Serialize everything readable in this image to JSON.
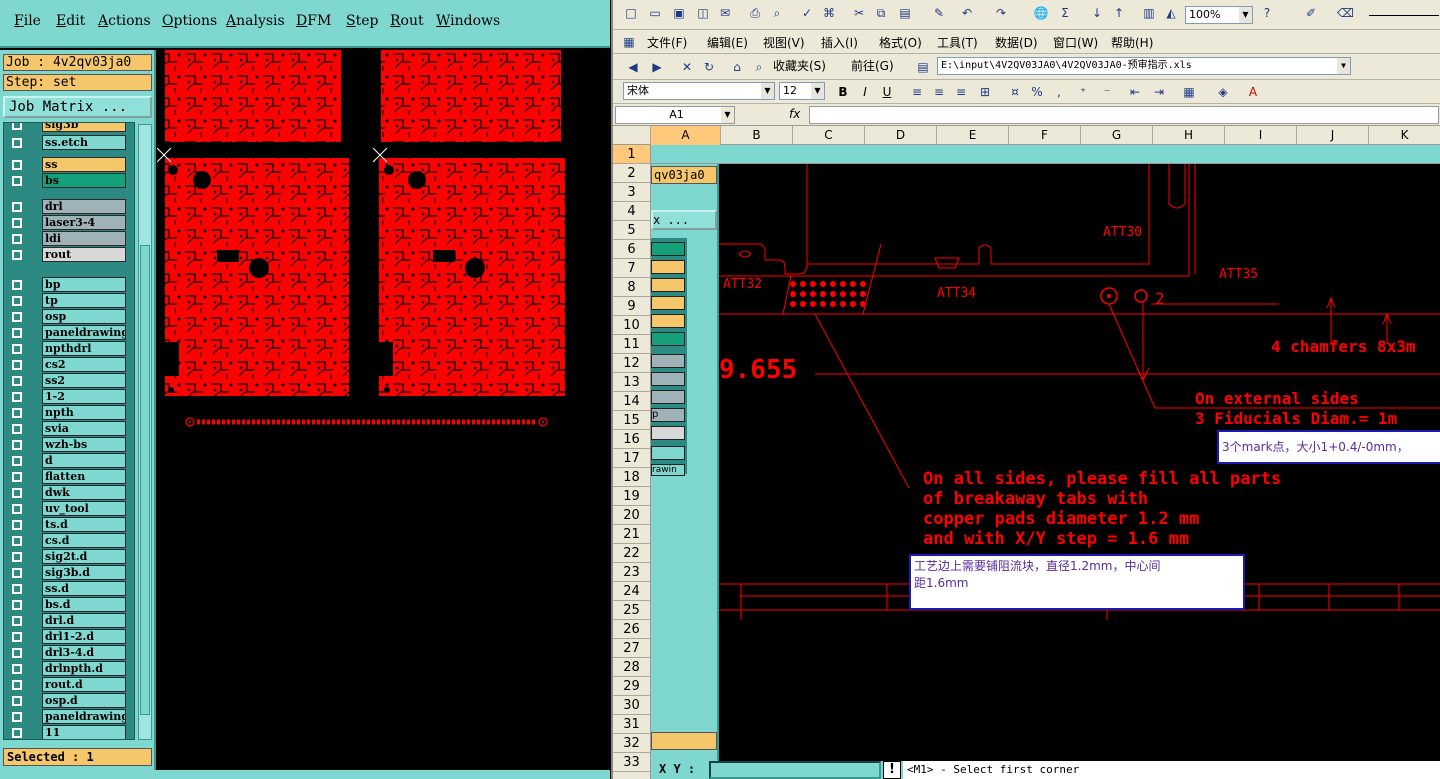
{
  "genesis": {
    "menu": [
      "File",
      "Edit",
      "Actions",
      "Options",
      "Analysis",
      "DFM",
      "Step",
      "Rout",
      "Windows"
    ],
    "job_label": "Job : 4v2qv03ja0",
    "step_label": "Step: set",
    "job_matrix_button": "Job Matrix ...",
    "layers": [
      {
        "name": "sig3b",
        "color": "yellow"
      },
      {
        "name": "ss.etch",
        "color": "plain"
      },
      {
        "name": "ss",
        "color": "yellow"
      },
      {
        "name": "bs",
        "color": "green"
      },
      {
        "name": "drl",
        "color": "gray"
      },
      {
        "name": "laser3-4",
        "color": "gray"
      },
      {
        "name": "ldi",
        "color": "gray"
      },
      {
        "name": "rout",
        "color": "lgray"
      },
      {
        "name": "bp",
        "color": "plain"
      },
      {
        "name": "tp",
        "color": "plain"
      },
      {
        "name": "osp",
        "color": "plain"
      },
      {
        "name": "paneldrawing",
        "color": "plain"
      },
      {
        "name": "npthdrl",
        "color": "plain"
      },
      {
        "name": "cs2",
        "color": "plain"
      },
      {
        "name": "ss2",
        "color": "plain"
      },
      {
        "name": "1-2",
        "color": "plain"
      },
      {
        "name": "npth",
        "color": "plain"
      },
      {
        "name": "svia",
        "color": "plain"
      },
      {
        "name": "wzh-bs",
        "color": "plain"
      },
      {
        "name": "d",
        "color": "plain"
      },
      {
        "name": "flatten",
        "color": "plain"
      },
      {
        "name": "dwk",
        "color": "plain"
      },
      {
        "name": "uv_tool",
        "color": "plain"
      },
      {
        "name": "ts.d",
        "color": "plain"
      },
      {
        "name": "cs.d",
        "color": "plain"
      },
      {
        "name": "sig2t.d",
        "color": "plain"
      },
      {
        "name": "sig3b.d",
        "color": "plain"
      },
      {
        "name": "ss.d",
        "color": "plain"
      },
      {
        "name": "bs.d",
        "color": "plain"
      },
      {
        "name": "drl.d",
        "color": "plain"
      },
      {
        "name": "drl1-2.d",
        "color": "plain"
      },
      {
        "name": "drl3-4.d",
        "color": "plain"
      },
      {
        "name": "drlnpth.d",
        "color": "plain"
      },
      {
        "name": "rout.d",
        "color": "plain"
      },
      {
        "name": "osp.d",
        "color": "plain"
      },
      {
        "name": "paneldrawing",
        "color": "plain"
      },
      {
        "name": "11",
        "color": "plain"
      }
    ],
    "selected_label": "Selected : 1"
  },
  "excel": {
    "menu": [
      "文件(F)",
      "编辑(E)",
      "视图(V)",
      "插入(I)",
      "格式(O)",
      "工具(T)",
      "数据(D)",
      "窗口(W)",
      "帮助(H)"
    ],
    "zoom": "100%",
    "favorites": "收藏夹(S)",
    "goto": "前往(G)",
    "address": "E:\\input\\4V2QV03JA0\\4V2QV03JA0-预审指示.xls",
    "font_name": "宋体",
    "font_size": "12",
    "name_box": "A1",
    "fx": "fx",
    "columns": [
      "A",
      "B",
      "C",
      "D",
      "E",
      "F",
      "G",
      "H",
      "I",
      "J",
      "K"
    ],
    "rows": [
      "1",
      "2",
      "3",
      "4",
      "5",
      "6",
      "7",
      "8",
      "9",
      "10",
      "11",
      "12",
      "13",
      "14",
      "15",
      "16",
      "17",
      "18",
      "19",
      "20",
      "21",
      "22",
      "23",
      "24",
      "25",
      "26",
      "27",
      "28",
      "29",
      "30",
      "31",
      "32",
      "33"
    ],
    "embedded": {
      "job_fragment": "qv03ja0",
      "matrix_fragment": "x ...",
      "layer_fragment_1": "p",
      "layer_fragment_2": "rawin",
      "xy_label": "X Y :",
      "bang": "!",
      "status": "<M1> - Select first corner",
      "dim_value": "9.655",
      "att30": "ATT30",
      "att32": "ATT32",
      "att34": "ATT34",
      "att35": "ATT35",
      "fid_num": "2",
      "chamfers": "4 chamfers 8x3m",
      "fid_line1": "On external sides",
      "fid_line2": "3 Fiducials Diam.= 1m",
      "note_lines": [
        "On all sides, please fill all parts",
        "of breakaway tabs with",
        "copper pads diameter 1.2 mm",
        "and with X/Y step = 1.6 mm"
      ]
    },
    "callouts": {
      "mark": "3个mark点，大小1+0.4/-0mm，",
      "pads_line1": "工艺边上需要铺阻流块，直径1.2mm，中心间",
      "pads_line2": "距1.6mm"
    }
  }
}
